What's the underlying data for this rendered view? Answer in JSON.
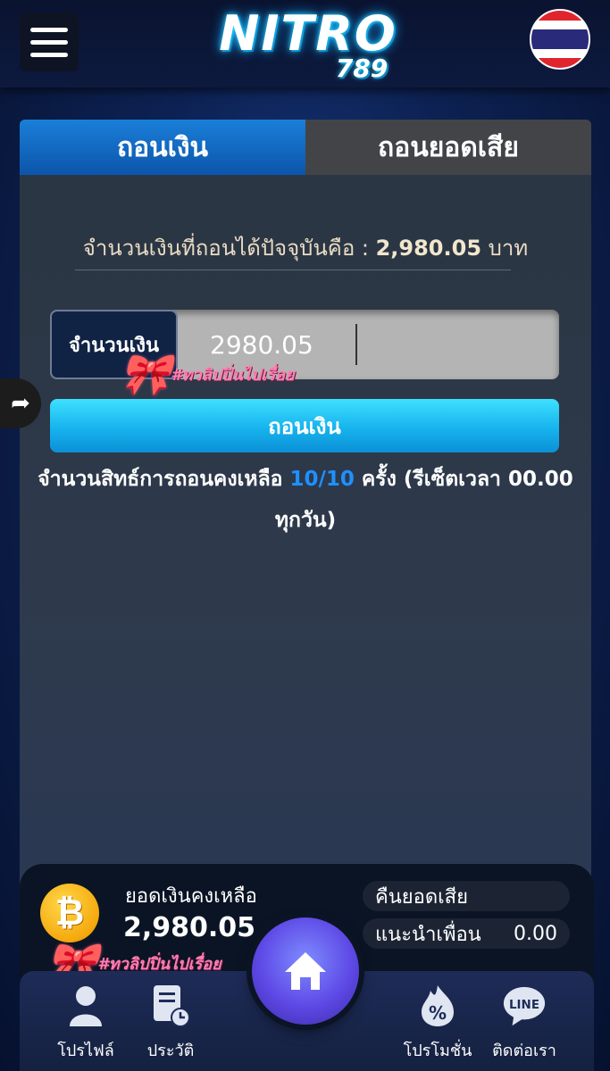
{
  "header": {
    "logo_main": "NITRO",
    "logo_sub": "789"
  },
  "tabs": [
    {
      "label": "ถอนเงิน",
      "active": true
    },
    {
      "label": "ถอนยอดเสีย",
      "active": false
    }
  ],
  "withdraw": {
    "available_prefix": "จำนวนเงินที่ถอนได้ปัจจุบันคือ : ",
    "available_amount": "2,980.05",
    "available_unit": " บาท",
    "amount_label": "จำนวนเงิน",
    "amount_value": "2980.05",
    "submit_label": "ถอนเงิน",
    "limit_prefix": "จำนวนสิทธ์การถอนคงเหลือ ",
    "limit_value": "10/10",
    "limit_suffix": " ครั้ง (รีเซ็ตเวลา 00.00 ทุกวัน)"
  },
  "stickers": {
    "text": "#ทวลิปปิ่นไปเรื่อย"
  },
  "wallet": {
    "balance_label": "ยอดเงินคงเหลือ",
    "balance_value": "2,980.05",
    "cashback_label": "คืนยอดเสีย",
    "referral_label": "แนะนำเพื่อน",
    "referral_value": "0.00"
  },
  "nav": {
    "profile": "โปรไฟล์",
    "history": "ประวัติ",
    "promotion": "โปรโมชั่น",
    "contact": "ติดต่อเรา",
    "line_badge": "LINE"
  },
  "colors": {
    "accent": "#1e90ff",
    "tab_active": "#0c55ab",
    "button": "#17b3ee"
  }
}
